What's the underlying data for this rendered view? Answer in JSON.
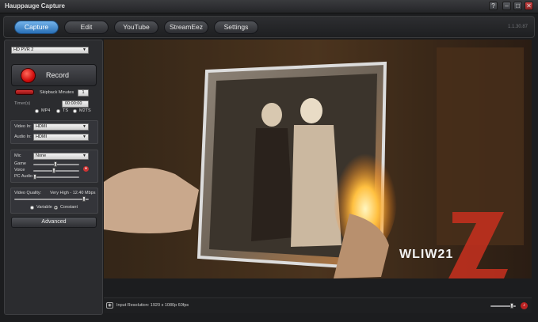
{
  "app": {
    "title": "Hauppauge Capture",
    "version": "1.1.30.87"
  },
  "window_controls": {
    "help": "?",
    "minimize": "–",
    "maximize": "□",
    "close": "✕"
  },
  "tabs": [
    {
      "label": "Capture",
      "active": true
    },
    {
      "label": "Edit",
      "active": false
    },
    {
      "label": "YouTube",
      "active": false
    },
    {
      "label": "StreamEez",
      "active": false
    },
    {
      "label": "Settings",
      "active": false
    }
  ],
  "capture": {
    "device": "HD PVR 2",
    "record_label": "Record",
    "skipback_label": "Skipback Minutes",
    "skipback_value": "1",
    "timer_label": "Timer(s)",
    "timer_value": "00:00:00",
    "formats": [
      {
        "label": "MP4",
        "selected": false
      },
      {
        "label": "TS",
        "selected": false
      },
      {
        "label": "M2TS",
        "selected": false
      }
    ],
    "video_in_label": "Video In:",
    "video_in_value": "HDMI",
    "audio_in_label": "Audio In:",
    "audio_in_value": "HDMI",
    "mic_label": "Mic",
    "mic_value": "None",
    "audio_levels": [
      {
        "label": "Game",
        "value": 0.48
      },
      {
        "label": "Voice",
        "value": 0.45
      },
      {
        "label": "PC Audio",
        "value": 0.0
      }
    ],
    "video_quality_label": "Video Quality:",
    "video_quality_value": "Very High - 12.40 Mbps",
    "video_quality_level": 0.95,
    "bitrate_modes": [
      {
        "label": "Variable",
        "selected": false
      },
      {
        "label": "Constant",
        "selected": true
      }
    ],
    "advanced_label": "Advanced"
  },
  "preview": {
    "watermark": "WLIW21"
  },
  "status": {
    "input_resolution": "Input Resolution: 1920 x 1080p 60fps",
    "volume_level": 0.88
  },
  "colors": {
    "accent": "#2a70b6",
    "record": "#d00d0d",
    "background": "#1c1d1f"
  }
}
